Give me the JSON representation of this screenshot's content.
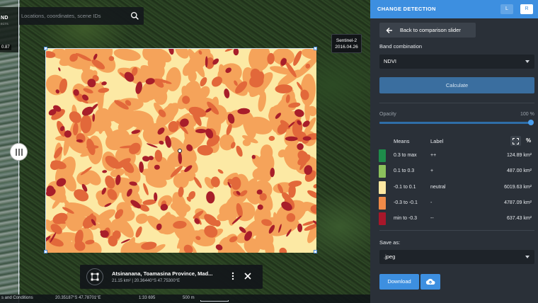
{
  "map": {
    "logo_text": "ND",
    "logo_sub": "ECTS",
    "left_date": "0.87",
    "search_placeholder": "Locations, coordinates, scene IDs",
    "right_source": "Sentinel-2",
    "right_date": "2016.04.26",
    "aoi": {
      "title": "Atsinanana, Toamasina Province, Mad...",
      "subtitle": "21.15 km² | 20.36440°S 47.75300°E"
    },
    "footer": {
      "terms": "s and Conditions",
      "coords": "20.35187°S 47.78701°E",
      "scale_ratio": "1:33 695",
      "scale_distance": "500 m"
    },
    "ndvi_colors": [
      "#fce9a4",
      "#f5a35a",
      "#e2683a",
      "#a81e2a"
    ]
  },
  "panel": {
    "title": "CHANGE DETECTION",
    "toggle_left": "L",
    "toggle_right": "R",
    "back_label": "Back to comparison slider",
    "band_combination_label": "Band combination",
    "band_value": "NDVI",
    "calculate_label": "Calculate",
    "opacity_label": "Opacity",
    "opacity_value": "100 %",
    "opacity_fraction": 1.0,
    "legend_headers": {
      "means": "Means",
      "label": "Label",
      "pct": "%"
    },
    "legend": [
      {
        "mean": "0.3 to max",
        "label": "++",
        "area": "124.89 km²",
        "color": "#1e8c4a"
      },
      {
        "mean": "0.1 to 0.3",
        "label": "+",
        "area": "487.00 km²",
        "color": "#8cc15c"
      },
      {
        "mean": "-0.1 to 0.1",
        "label": "neutral",
        "area": "6019.63 km²",
        "color": "#fde8a2"
      },
      {
        "mean": "-0.3 to -0.1",
        "label": "-",
        "area": "4787.09 km²",
        "color": "#f08a48"
      },
      {
        "mean": "min to -0.3",
        "label": "--",
        "area": "637.43 km²",
        "color": "#a8172a"
      }
    ],
    "save_as_label": "Save as:",
    "save_format": ".jpeg",
    "download_label": "Download",
    "accent": "#3d8fe0"
  }
}
